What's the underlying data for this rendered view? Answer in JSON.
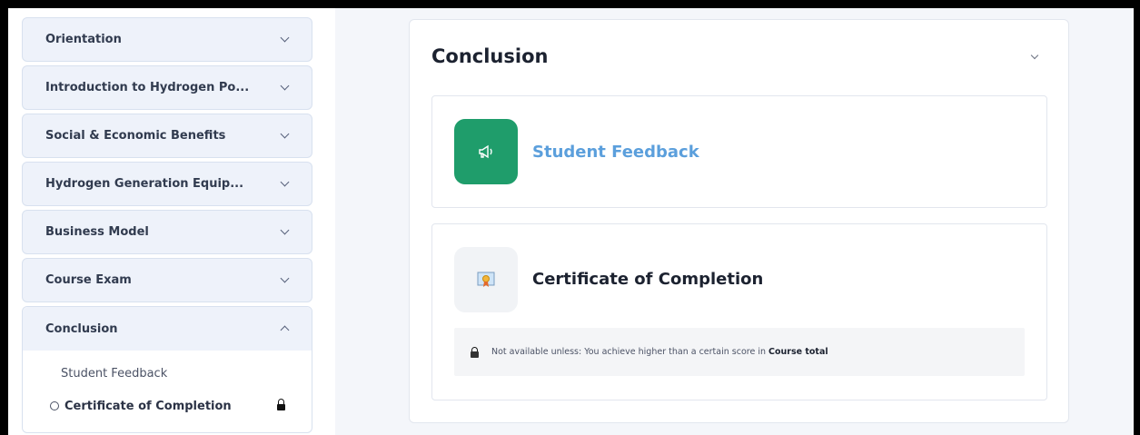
{
  "sidebar": {
    "sections": [
      {
        "label": "Orientation"
      },
      {
        "label": "Introduction to Hydrogen Po..."
      },
      {
        "label": "Social & Economic Benefits"
      },
      {
        "label": "Hydrogen Generation Equip..."
      },
      {
        "label": "Business Model"
      },
      {
        "label": "Course Exam"
      },
      {
        "label": "Conclusion",
        "expanded": true,
        "items": [
          {
            "label": "Student Feedback"
          },
          {
            "label": "Certificate of Completion",
            "current": true,
            "locked": true
          }
        ]
      }
    ]
  },
  "main": {
    "title": "Conclusion",
    "activities": [
      {
        "name": "Student Feedback",
        "icon": "megaphone-icon",
        "icon_bg": "#1f9d6b",
        "name_color": "#5b9fdc"
      },
      {
        "name": "Certificate of Completion",
        "icon": "certificate-icon",
        "icon_bg": "#f1f3f6",
        "name_color": "#1c2230",
        "restriction": {
          "prefix": "Not available unless: You achieve higher than a certain score in",
          "target": "Course total"
        }
      }
    ]
  }
}
